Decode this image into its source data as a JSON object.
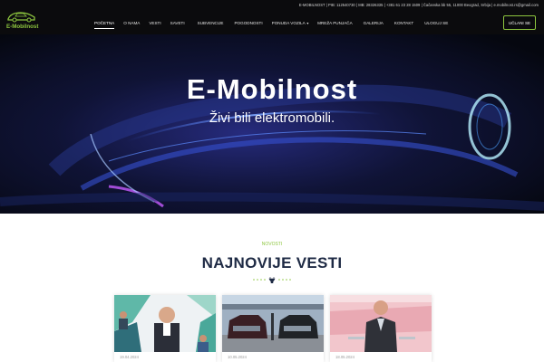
{
  "header": {
    "contact": "E-MOBILNOST | PIB: 112540730 | MB: 28326335 | +381 61 23 28 1509 | Čačanska bb 55, 11000 Beograd, Srbija | e.mobilnost.rs@gmail.com",
    "logo_text": "E-Mobilnost",
    "login_label": "UČLANI SE",
    "nav": [
      {
        "label": "Početna"
      },
      {
        "label": "O nama"
      },
      {
        "label": "Vesti"
      },
      {
        "label": "Saveti"
      },
      {
        "label": "Subvencije"
      },
      {
        "label": "Pogodnosti"
      },
      {
        "label": "Ponuda vozila"
      },
      {
        "label": "Mreža punjača"
      },
      {
        "label": "Galerija"
      },
      {
        "label": "Kontakt"
      },
      {
        "label": "Uloguj se"
      }
    ]
  },
  "hero": {
    "title": "E-Mobilnost",
    "subtitle": "Živi bili elektromobili."
  },
  "news": {
    "kicker": "NOVOSTI",
    "title": "NAJNOVIJE VESTI",
    "cards": [
      {
        "date": "19.04.2024"
      },
      {
        "date": "10.05.2024"
      },
      {
        "date": "18.05.2024"
      }
    ]
  },
  "colors": {
    "accent": "#8dc63f",
    "topbar": "#0b0b0d",
    "heading": "#1e2a44"
  }
}
